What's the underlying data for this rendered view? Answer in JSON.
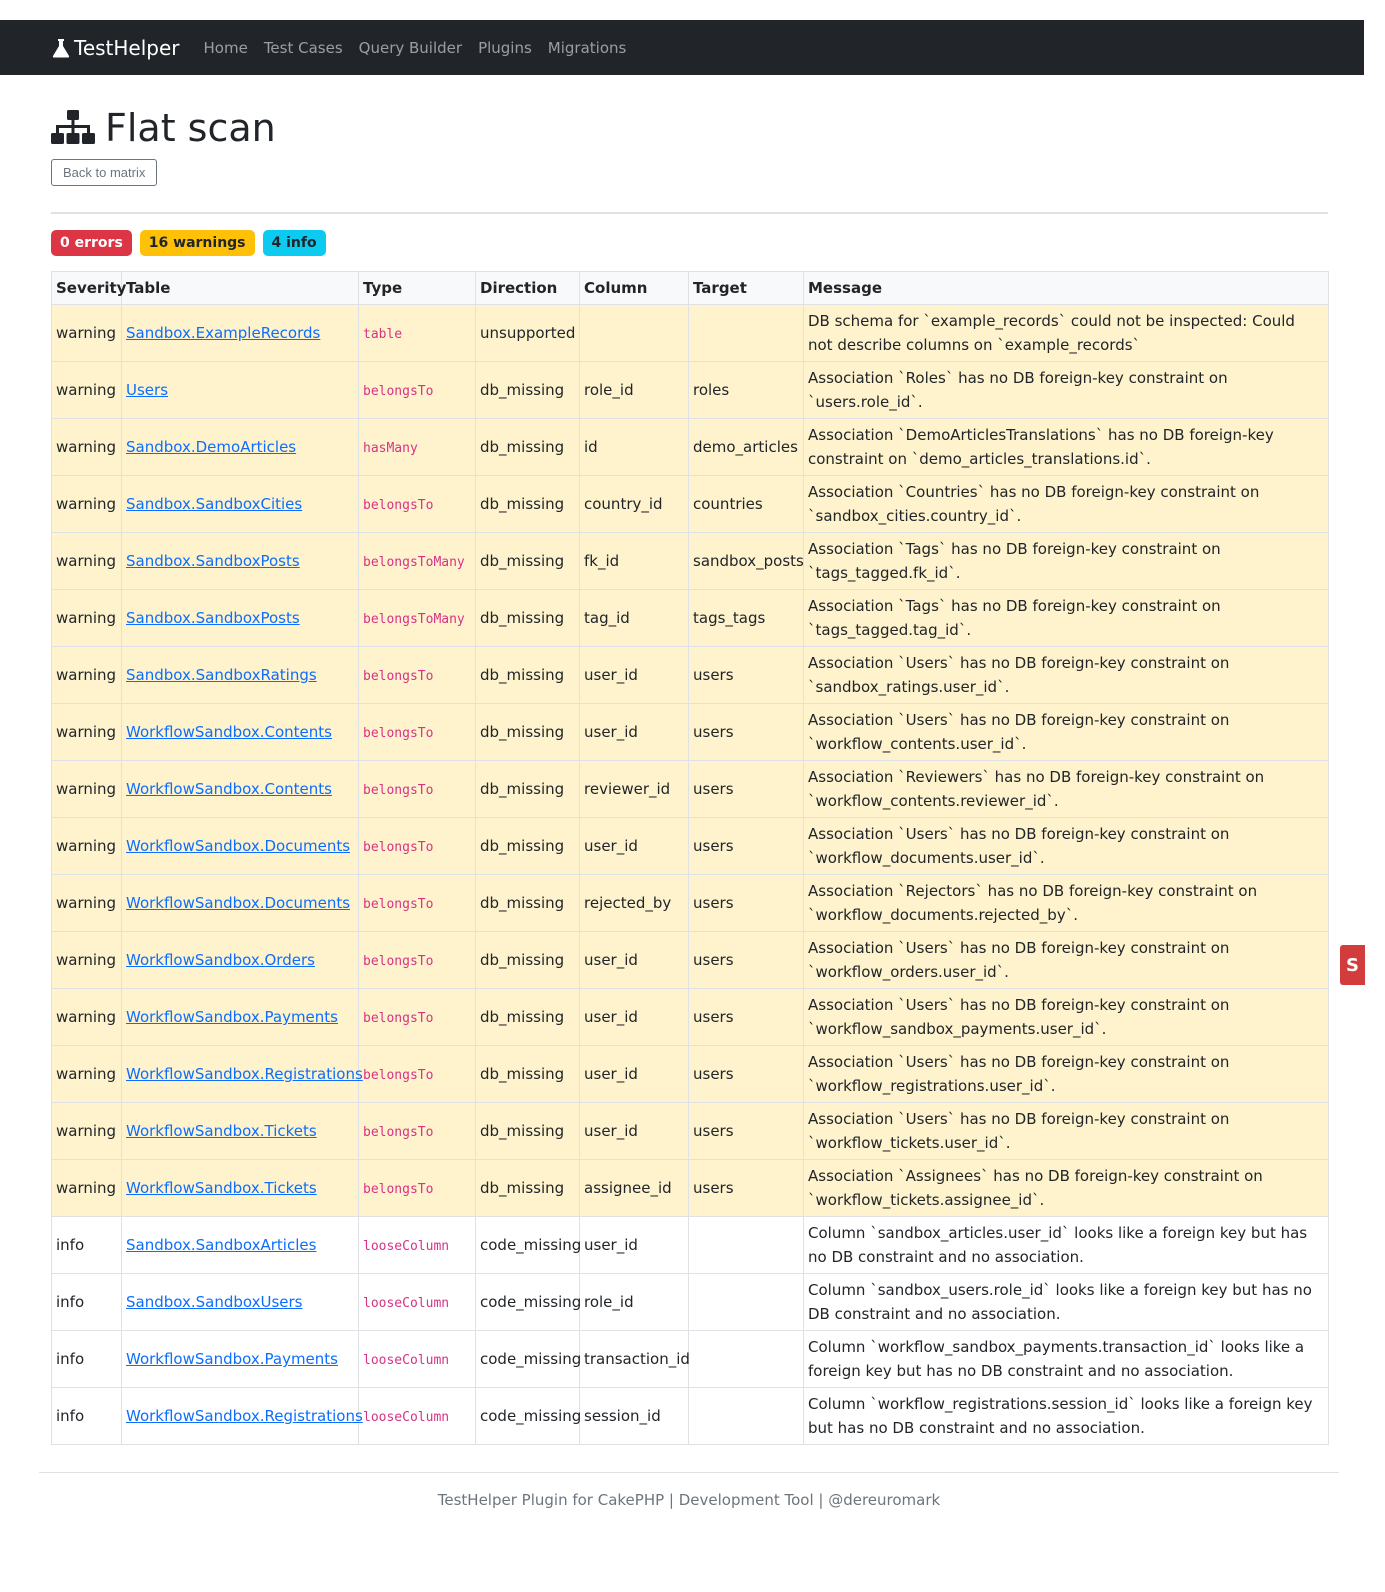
{
  "navbar": {
    "brand": "TestHelper",
    "links": [
      "Home",
      "Test Cases",
      "Query Builder",
      "Plugins",
      "Migrations"
    ]
  },
  "page": {
    "title": "Flat scan",
    "back_label": "Back to matrix"
  },
  "badges": {
    "errors": "0 errors",
    "warnings": "16 warnings",
    "info": "4 info"
  },
  "table": {
    "headers": [
      "Severity",
      "Table",
      "Type",
      "Direction",
      "Column",
      "Target",
      "Message"
    ],
    "rows": [
      {
        "severity": "warning",
        "table": "Sandbox.ExampleRecords",
        "type": "table",
        "direction": "unsupported",
        "column": "",
        "target": "",
        "message": "DB schema for `example_records` could not be inspected: Could not describe columns on `example_records`"
      },
      {
        "severity": "warning",
        "table": "Users",
        "type": "belongsTo",
        "direction": "db_missing",
        "column": "role_id",
        "target": "roles",
        "message": "Association `Roles` has no DB foreign-key constraint on `users.role_id`."
      },
      {
        "severity": "warning",
        "table": "Sandbox.DemoArticles",
        "type": "hasMany",
        "direction": "db_missing",
        "column": "id",
        "target": "demo_articles",
        "message": "Association `DemoArticlesTranslations` has no DB foreign-key constraint on `demo_articles_translations.id`."
      },
      {
        "severity": "warning",
        "table": "Sandbox.SandboxCities",
        "type": "belongsTo",
        "direction": "db_missing",
        "column": "country_id",
        "target": "countries",
        "message": "Association `Countries` has no DB foreign-key constraint on `sandbox_cities.country_id`."
      },
      {
        "severity": "warning",
        "table": "Sandbox.SandboxPosts",
        "type": "belongsToMany",
        "direction": "db_missing",
        "column": "fk_id",
        "target": "sandbox_posts",
        "message": "Association `Tags` has no DB foreign-key constraint on `tags_tagged.fk_id`."
      },
      {
        "severity": "warning",
        "table": "Sandbox.SandboxPosts",
        "type": "belongsToMany",
        "direction": "db_missing",
        "column": "tag_id",
        "target": "tags_tags",
        "message": "Association `Tags` has no DB foreign-key constraint on `tags_tagged.tag_id`."
      },
      {
        "severity": "warning",
        "table": "Sandbox.SandboxRatings",
        "type": "belongsTo",
        "direction": "db_missing",
        "column": "user_id",
        "target": "users",
        "message": "Association `Users` has no DB foreign-key constraint on `sandbox_ratings.user_id`."
      },
      {
        "severity": "warning",
        "table": "WorkflowSandbox.Contents",
        "type": "belongsTo",
        "direction": "db_missing",
        "column": "user_id",
        "target": "users",
        "message": "Association `Users` has no DB foreign-key constraint on `workflow_contents.user_id`."
      },
      {
        "severity": "warning",
        "table": "WorkflowSandbox.Contents",
        "type": "belongsTo",
        "direction": "db_missing",
        "column": "reviewer_id",
        "target": "users",
        "message": "Association `Reviewers` has no DB foreign-key constraint on `workflow_contents.reviewer_id`."
      },
      {
        "severity": "warning",
        "table": "WorkflowSandbox.Documents",
        "type": "belongsTo",
        "direction": "db_missing",
        "column": "user_id",
        "target": "users",
        "message": "Association `Users` has no DB foreign-key constraint on `workflow_documents.user_id`."
      },
      {
        "severity": "warning",
        "table": "WorkflowSandbox.Documents",
        "type": "belongsTo",
        "direction": "db_missing",
        "column": "rejected_by",
        "target": "users",
        "message": "Association `Rejectors` has no DB foreign-key constraint on `workflow_documents.rejected_by`."
      },
      {
        "severity": "warning",
        "table": "WorkflowSandbox.Orders",
        "type": "belongsTo",
        "direction": "db_missing",
        "column": "user_id",
        "target": "users",
        "message": "Association `Users` has no DB foreign-key constraint on `workflow_orders.user_id`."
      },
      {
        "severity": "warning",
        "table": "WorkflowSandbox.Payments",
        "type": "belongsTo",
        "direction": "db_missing",
        "column": "user_id",
        "target": "users",
        "message": "Association `Users` has no DB foreign-key constraint on `workflow_sandbox_payments.user_id`."
      },
      {
        "severity": "warning",
        "table": "WorkflowSandbox.Registrations",
        "type": "belongsTo",
        "direction": "db_missing",
        "column": "user_id",
        "target": "users",
        "message": "Association `Users` has no DB foreign-key constraint on `workflow_registrations.user_id`."
      },
      {
        "severity": "warning",
        "table": "WorkflowSandbox.Tickets",
        "type": "belongsTo",
        "direction": "db_missing",
        "column": "user_id",
        "target": "users",
        "message": "Association `Users` has no DB foreign-key constraint on `workflow_tickets.user_id`."
      },
      {
        "severity": "warning",
        "table": "WorkflowSandbox.Tickets",
        "type": "belongsTo",
        "direction": "db_missing",
        "column": "assignee_id",
        "target": "users",
        "message": "Association `Assignees` has no DB foreign-key constraint on `workflow_tickets.assignee_id`."
      },
      {
        "severity": "info",
        "table": "Sandbox.SandboxArticles",
        "type": "looseColumn",
        "direction": "code_missing",
        "column": "user_id",
        "target": "",
        "message": "Column `sandbox_articles.user_id` looks like a foreign key but has no DB constraint and no association."
      },
      {
        "severity": "info",
        "table": "Sandbox.SandboxUsers",
        "type": "looseColumn",
        "direction": "code_missing",
        "column": "role_id",
        "target": "",
        "message": "Column `sandbox_users.role_id` looks like a foreign key but has no DB constraint and no association."
      },
      {
        "severity": "info",
        "table": "WorkflowSandbox.Payments",
        "type": "looseColumn",
        "direction": "code_missing",
        "column": "transaction_id",
        "target": "",
        "message": "Column `workflow_sandbox_payments.transaction_id` looks like a foreign key but has no DB constraint and no association."
      },
      {
        "severity": "info",
        "table": "WorkflowSandbox.Registrations",
        "type": "looseColumn",
        "direction": "code_missing",
        "column": "session_id",
        "target": "",
        "message": "Column `workflow_registrations.session_id` looks like a foreign key but has no DB constraint and no association."
      }
    ]
  },
  "footer": {
    "text": "TestHelper Plugin for CakePHP | Development Tool | @dereuromark"
  },
  "side_tab": {
    "glyph": "S"
  },
  "colors": {
    "navbar": "#212529",
    "warning_row": "#fff3cd",
    "error_badge": "#dc3545",
    "warning_badge": "#ffc107",
    "info_badge": "#0dcaf0",
    "link": "#0d6efd",
    "code": "#d63384"
  },
  "icons": {
    "brand": "flask-icon",
    "title": "sitemap-icon"
  }
}
